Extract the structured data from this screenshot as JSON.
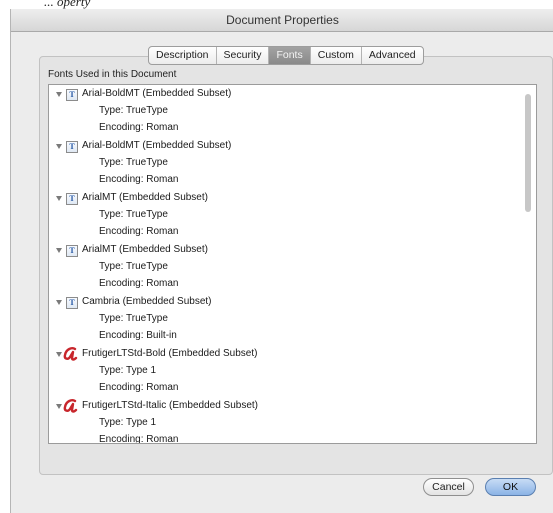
{
  "header_caption": "... operty",
  "window": {
    "title": "Document Properties"
  },
  "tabs": [
    {
      "label": "Description",
      "active": false
    },
    {
      "label": "Security",
      "active": false
    },
    {
      "label": "Fonts",
      "active": true
    },
    {
      "label": "Custom",
      "active": false
    },
    {
      "label": "Advanced",
      "active": false
    }
  ],
  "section_label": "Fonts Used in this Document",
  "fonts": [
    {
      "icon": "truetype-icon",
      "name": "Arial-BoldMT (Embedded Subset)",
      "type": "Type: TrueType",
      "encoding": "Encoding: Roman"
    },
    {
      "icon": "truetype-icon",
      "name": "Arial-BoldMT (Embedded Subset)",
      "type": "Type: TrueType",
      "encoding": "Encoding: Roman"
    },
    {
      "icon": "truetype-icon",
      "name": "ArialMT (Embedded Subset)",
      "type": "Type: TrueType",
      "encoding": "Encoding: Roman"
    },
    {
      "icon": "truetype-icon",
      "name": "ArialMT (Embedded Subset)",
      "type": "Type: TrueType",
      "encoding": "Encoding: Roman"
    },
    {
      "icon": "truetype-icon",
      "name": "Cambria (Embedded Subset)",
      "type": "Type: TrueType",
      "encoding": "Encoding: Built-in"
    },
    {
      "icon": "type1-icon",
      "name": "FrutigerLTStd-Bold (Embedded Subset)",
      "type": "Type: Type 1",
      "encoding": "Encoding: Roman"
    },
    {
      "icon": "type1-icon",
      "name": "FrutigerLTStd-Italic (Embedded Subset)",
      "type": "Type: Type 1",
      "encoding": "Encoding: Roman"
    }
  ],
  "buttons": {
    "cancel": "Cancel",
    "ok": "OK"
  },
  "colors": {
    "active_tab": "#8a8a8a",
    "type1_icon": "#c8262c",
    "ok_button": "#8bb3e6"
  }
}
